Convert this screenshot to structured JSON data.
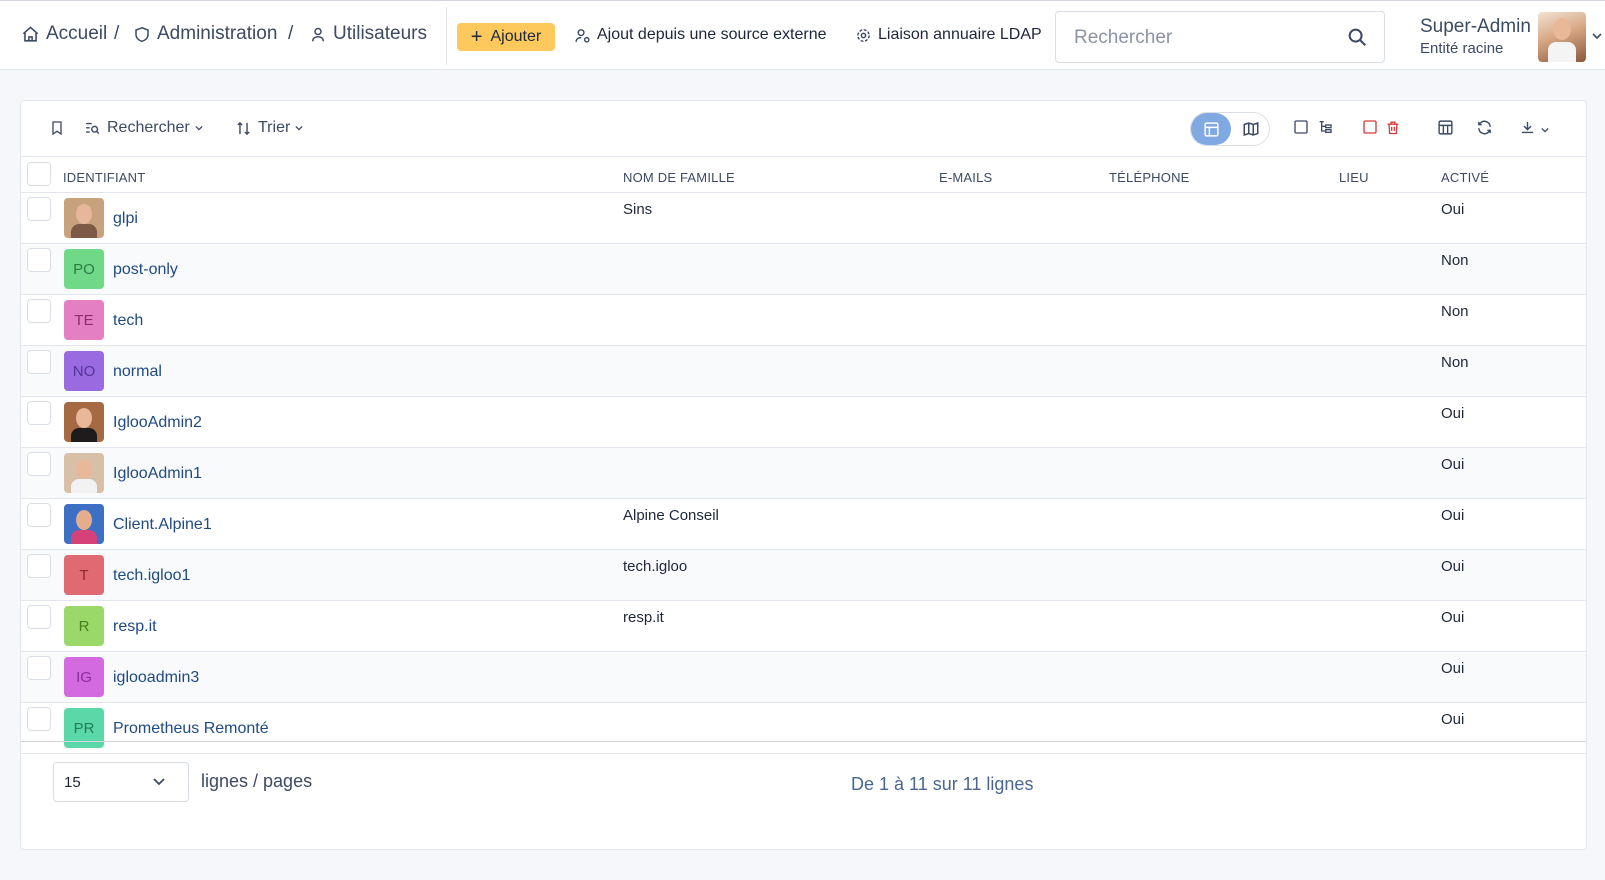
{
  "breadcrumb": [
    {
      "label": "Accueil"
    },
    {
      "label": "Administration"
    },
    {
      "label": "Utilisateurs"
    }
  ],
  "breadcrumb_separator": "/",
  "header_actions": {
    "add_label": "Ajouter",
    "external_source_label": "Ajout depuis une source externe",
    "ldap_label": "Liaison annuaire LDAP"
  },
  "search": {
    "placeholder": "Rechercher"
  },
  "user": {
    "name": "Super-Admin",
    "entity": "Entité racine"
  },
  "toolbar": {
    "search_label": "Rechercher",
    "sort_label": "Trier"
  },
  "table": {
    "columns": [
      "IDENTIFIANT",
      "NOM DE FAMILLE",
      "E-MAILS",
      "TÉLÉPHONE",
      "LIEU",
      "ACTIVÉ"
    ],
    "rows": [
      {
        "login": "glpi",
        "lastname": "Sins",
        "emails": "",
        "phone": "",
        "location": "",
        "active": "Oui",
        "avatar": {
          "type": "photo",
          "bg": "#c8a27d",
          "head": "#e6b79a",
          "body": "#7c5a46"
        }
      },
      {
        "login": "post-only",
        "lastname": "",
        "emails": "",
        "phone": "",
        "location": "",
        "active": "Non",
        "avatar": {
          "type": "initials",
          "initials": "PO",
          "bg": "#6fd987",
          "fg": "#2b7a45"
        }
      },
      {
        "login": "tech",
        "lastname": "",
        "emails": "",
        "phone": "",
        "location": "",
        "active": "Non",
        "avatar": {
          "type": "initials",
          "initials": "TE",
          "bg": "#e47fc4",
          "fg": "#8a2d6d"
        }
      },
      {
        "login": "normal",
        "lastname": "",
        "emails": "",
        "phone": "",
        "location": "",
        "active": "Non",
        "avatar": {
          "type": "initials",
          "initials": "NO",
          "bg": "#9a6ae0",
          "fg": "#53339a"
        }
      },
      {
        "login": "IglooAdmin2",
        "lastname": "",
        "emails": "",
        "phone": "",
        "location": "",
        "active": "Oui",
        "avatar": {
          "type": "photo",
          "bg": "#a56a42",
          "head": "#e8b898",
          "body": "#1e1b1d"
        }
      },
      {
        "login": "IglooAdmin1",
        "lastname": "",
        "emails": "",
        "phone": "",
        "location": "",
        "active": "Oui",
        "avatar": {
          "type": "photo",
          "bg": "#d8c0a8",
          "head": "#e8b898",
          "body": "#f2f2f2"
        }
      },
      {
        "login": "Client.Alpine1",
        "lastname": "Alpine Conseil",
        "emails": "",
        "phone": "",
        "location": "",
        "active": "Oui",
        "avatar": {
          "type": "photo",
          "bg": "#3d6fc4",
          "head": "#e3ad8e",
          "body": "#d6417a"
        }
      },
      {
        "login": "tech.igloo1",
        "lastname": "tech.igloo",
        "emails": "",
        "phone": "",
        "location": "",
        "active": "Oui",
        "avatar": {
          "type": "initials",
          "initials": "T",
          "bg": "#df6a72",
          "fg": "#8a2a32"
        }
      },
      {
        "login": "resp.it",
        "lastname": "resp.it",
        "emails": "",
        "phone": "",
        "location": "",
        "active": "Oui",
        "avatar": {
          "type": "initials",
          "initials": "R",
          "bg": "#9bd86a",
          "fg": "#4b7f22"
        }
      },
      {
        "login": "iglooadmin3",
        "lastname": "",
        "emails": "",
        "phone": "",
        "location": "",
        "active": "Oui",
        "avatar": {
          "type": "initials",
          "initials": "IG",
          "bg": "#d46ae0",
          "fg": "#8a2d99"
        }
      },
      {
        "login": "Prometheus Remonté",
        "lastname": "",
        "emails": "",
        "phone": "",
        "location": "",
        "active": "Oui",
        "avatar": {
          "type": "initials",
          "initials": "PR",
          "bg": "#5bd8a8",
          "fg": "#237a58"
        }
      }
    ]
  },
  "pagination": {
    "per_page": "15",
    "per_page_label": "lignes / pages",
    "info": "De 1 à 11 sur 11 lignes"
  },
  "colors": {
    "accent": "#fec95c",
    "link": "#1f4a84",
    "view_active": "#7fa9e0",
    "delete": "#d63939"
  }
}
